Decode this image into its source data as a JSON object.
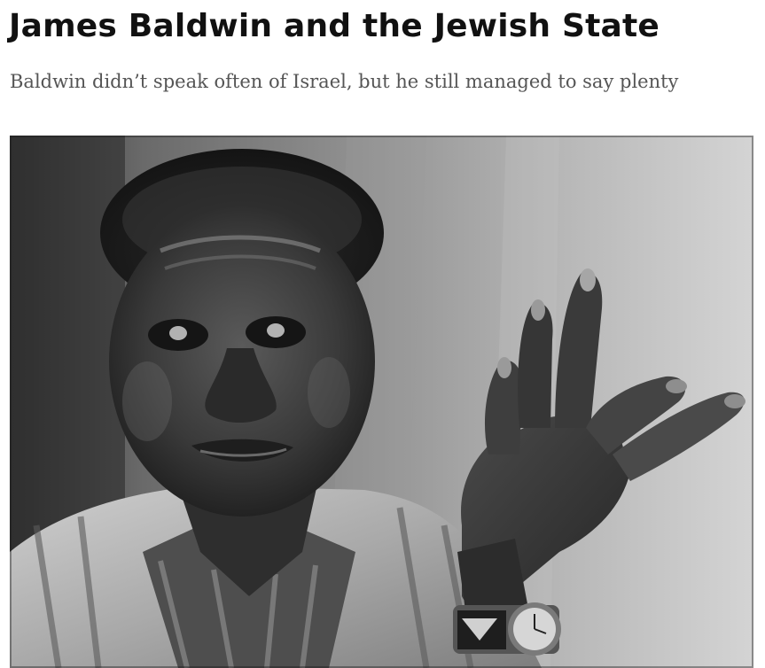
{
  "article": {
    "headline": "James Baldwin and the Jewish State",
    "dek": "Baldwin didn’t speak often of Israel, but he still managed to say plenty"
  },
  "photo": {
    "style": "black-and-white",
    "subject": "portrait-raised-hand"
  }
}
